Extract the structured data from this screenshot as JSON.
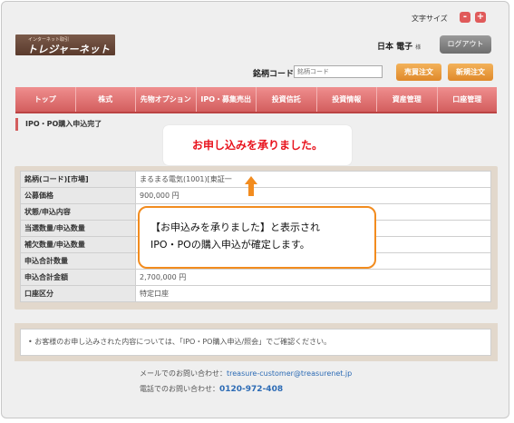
{
  "header": {
    "font_size_label": "文字サイズ",
    "font_minus": "-",
    "font_plus": "+",
    "logo_sub": "インターネット取引",
    "logo_main": "トレジャーネット",
    "user_name": "日本 電子",
    "user_suffix": "様",
    "logout_label": "ログアウト"
  },
  "search": {
    "label": "銘柄コード",
    "placeholder": "銘柄コード",
    "sell_button": "売買注文",
    "new_button": "新規注文"
  },
  "nav": {
    "items": [
      {
        "label": "トップ"
      },
      {
        "label": "株式"
      },
      {
        "label": "先物オプション"
      },
      {
        "label": "IPO・募集売出"
      },
      {
        "label": "投資信託"
      },
      {
        "label": "投資情報"
      },
      {
        "label": "資産管理"
      },
      {
        "label": "口座管理"
      }
    ]
  },
  "page": {
    "title": "IPO・PO購入申込完了",
    "callout": "お申し込みを承りました。"
  },
  "table": {
    "rows": [
      {
        "label": "銘柄(コード)[市場]",
        "value": "まるまる電気(1001)[東証一"
      },
      {
        "label": "公募価格",
        "value": "900,000 円"
      },
      {
        "label": "状態/申込内容",
        "value": ""
      },
      {
        "label": "当選数量/申込数量",
        "value": ""
      },
      {
        "label": "補欠数量/申込数量",
        "value": ""
      },
      {
        "label": "申込合計数量",
        "value": ""
      },
      {
        "label": "申込合計金額",
        "value": "2,700,000 円"
      },
      {
        "label": "口座区分",
        "value": "特定口座"
      }
    ]
  },
  "bubble": {
    "line1": "【お申込みを承りました】と表示され",
    "line2": "IPO・POの購入申込が確定します。"
  },
  "note": {
    "text": "• お客様のお申し込みされた内容については、「IPO・PO購入申込/照会」でご確認ください。"
  },
  "contact": {
    "email_label": "メールでのお問い合わせ：",
    "email": "treasure-customer@treasurenet.jp",
    "phone_label": "電話でのお問い合わせ：",
    "phone": "0120-972-408"
  },
  "colors": {
    "nav": "#d35e5e",
    "sell_button": "#e89b3c",
    "new_button": "#e8a23e",
    "callout_text": "#e8121c",
    "bubble_border": "#f28c1f"
  }
}
